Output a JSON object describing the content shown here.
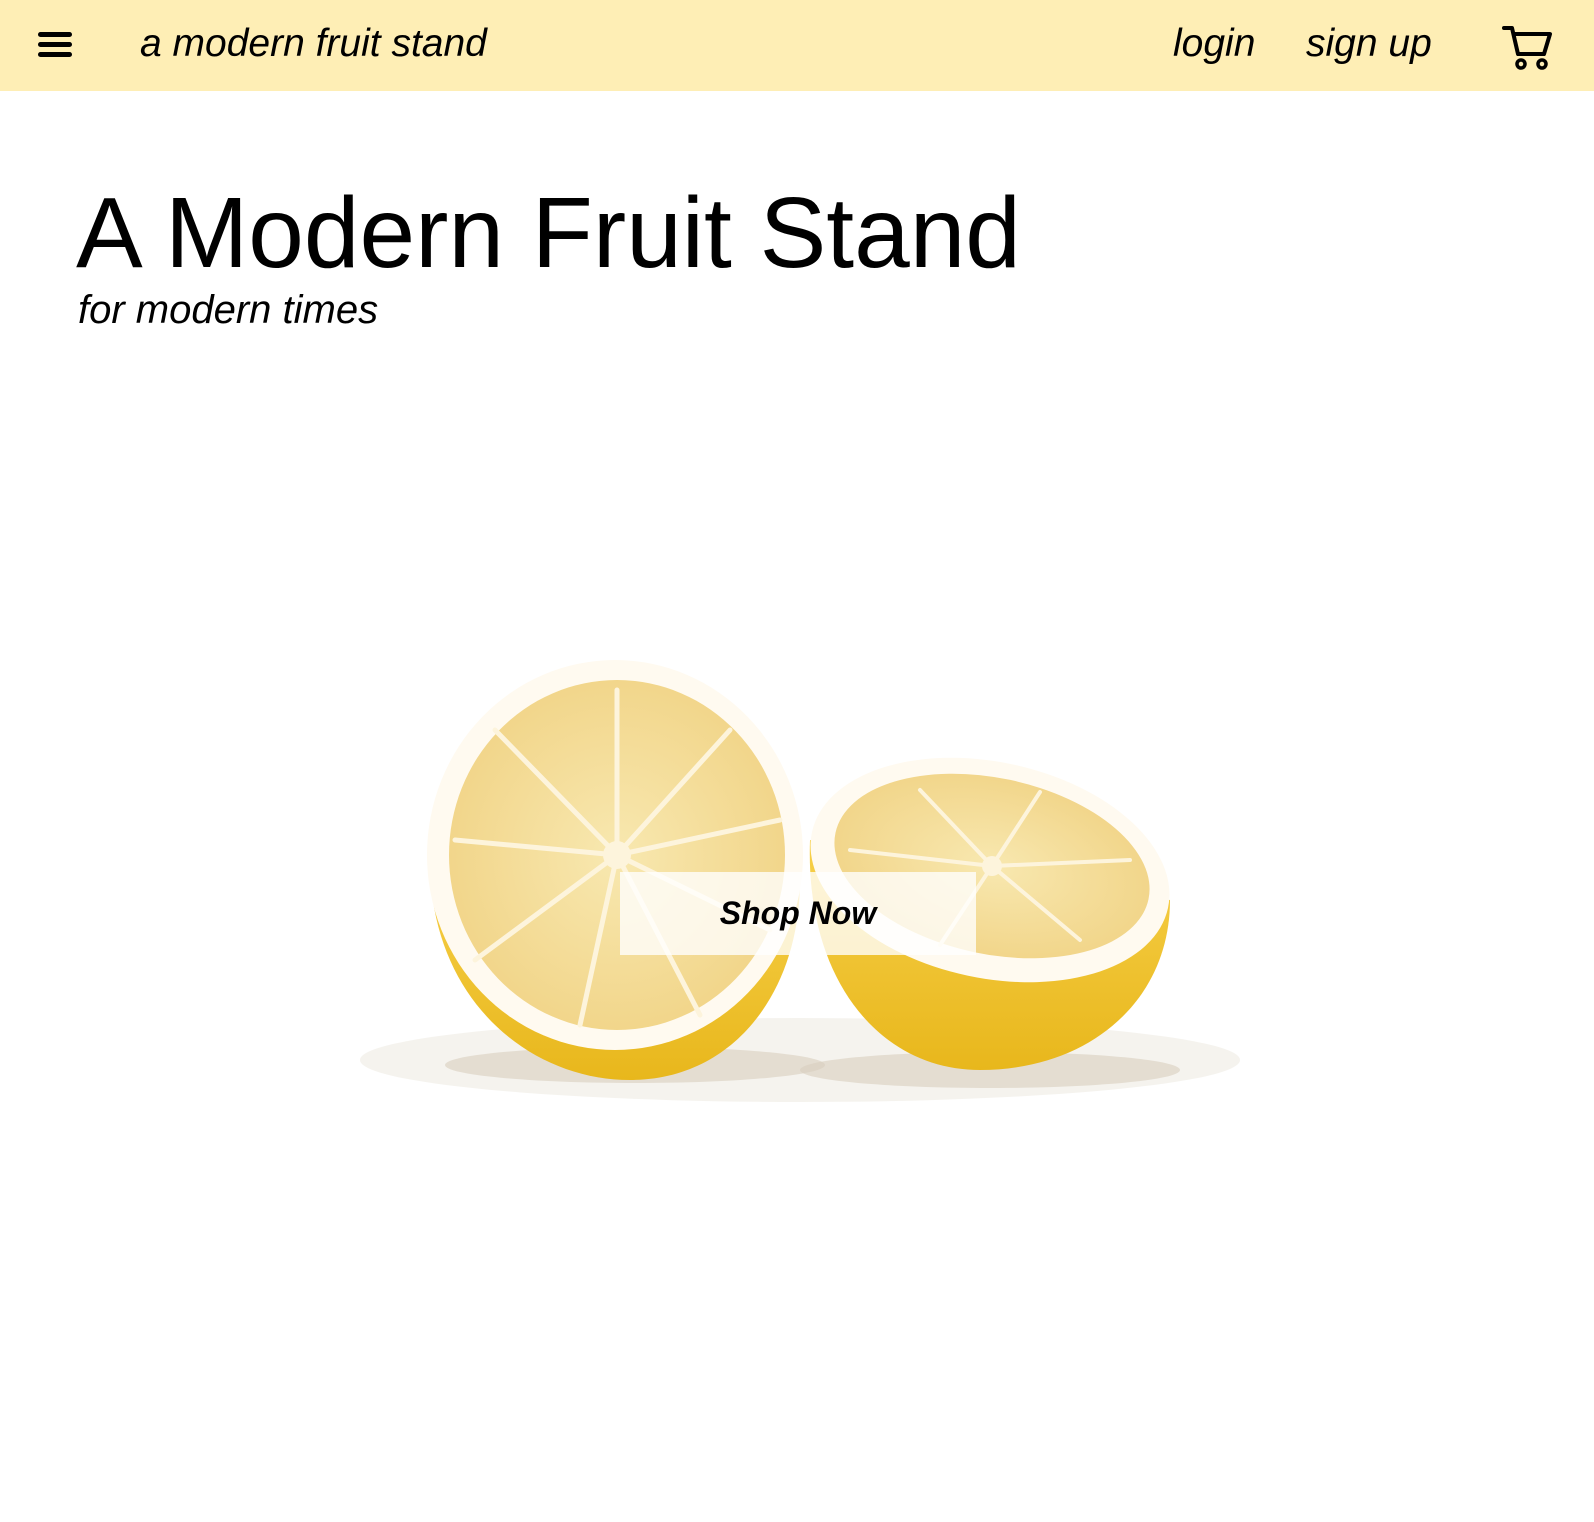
{
  "colors": {
    "navbar_background": "#feeeb5",
    "page_background": "#ffffff",
    "text": "#000000",
    "lemon_rind": "#f2c42a",
    "lemon_flesh": "#f5dc8f",
    "lemon_pith": "#fffaf0"
  },
  "navbar": {
    "menu_icon": "hamburger-menu-icon",
    "brand": "a modern fruit stand",
    "links": {
      "login": "login",
      "signup": "sign up"
    },
    "cart_icon": "shopping-cart-icon"
  },
  "hero": {
    "title": "A Modern Fruit Stand",
    "subtitle": "for modern times",
    "image": "two-lemon-halves",
    "cta_label": "Shop Now"
  }
}
